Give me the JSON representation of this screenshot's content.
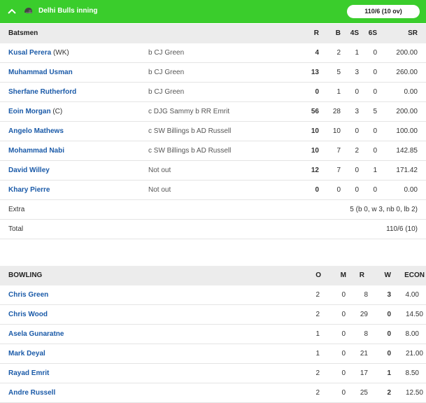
{
  "header": {
    "team_title": "Delhi Bulls inning",
    "score_pill": "110/6 (10 ov)"
  },
  "batting": {
    "columns": {
      "name": "Batsmen",
      "r": "R",
      "b": "B",
      "fours": "4S",
      "sixes": "6S",
      "sr": "SR"
    },
    "rows": [
      {
        "name": "Kusal Perera",
        "suffix": "(WK)",
        "dismissal": "b CJ Green",
        "r": "4",
        "b": "2",
        "fours": "1",
        "sixes": "0",
        "sr": "200.00"
      },
      {
        "name": "Muhammad Usman",
        "suffix": "",
        "dismissal": "b CJ Green",
        "r": "13",
        "b": "5",
        "fours": "3",
        "sixes": "0",
        "sr": "260.00"
      },
      {
        "name": "Sherfane Rutherford",
        "suffix": "",
        "dismissal": "b CJ Green",
        "r": "0",
        "b": "1",
        "fours": "0",
        "sixes": "0",
        "sr": "0.00"
      },
      {
        "name": "Eoin Morgan",
        "suffix": "(C)",
        "dismissal": "c DJG Sammy b RR Emrit",
        "r": "56",
        "b": "28",
        "fours": "3",
        "sixes": "5",
        "sr": "200.00"
      },
      {
        "name": "Angelo Mathews",
        "suffix": "",
        "dismissal": "c SW Billings b AD Russell",
        "r": "10",
        "b": "10",
        "fours": "0",
        "sixes": "0",
        "sr": "100.00"
      },
      {
        "name": "Mohammad Nabi",
        "suffix": "",
        "dismissal": "c SW Billings b AD Russell",
        "r": "10",
        "b": "7",
        "fours": "2",
        "sixes": "0",
        "sr": "142.85"
      },
      {
        "name": "David Willey",
        "suffix": "",
        "dismissal": "Not out",
        "r": "12",
        "b": "7",
        "fours": "0",
        "sixes": "1",
        "sr": "171.42"
      },
      {
        "name": "Khary Pierre",
        "suffix": "",
        "dismissal": "Not out",
        "r": "0",
        "b": "0",
        "fours": "0",
        "sixes": "0",
        "sr": "0.00"
      }
    ],
    "extra_label": "Extra",
    "extra_value": "5 (b 0, w 3, nb 0, lb 2)",
    "total_label": "Total",
    "total_value": "110/6 (10)"
  },
  "bowling": {
    "columns": {
      "name": "BOWLING",
      "o": "O",
      "m": "M",
      "r": "R",
      "w": "W",
      "econ": "ECON"
    },
    "rows": [
      {
        "name": "Chris Green",
        "o": "2",
        "m": "0",
        "r": "8",
        "w": "3",
        "econ": "4.00"
      },
      {
        "name": "Chris Wood",
        "o": "2",
        "m": "0",
        "r": "29",
        "w": "0",
        "econ": "14.50"
      },
      {
        "name": "Asela Gunaratne",
        "o": "1",
        "m": "0",
        "r": "8",
        "w": "0",
        "econ": "8.00"
      },
      {
        "name": "Mark Deyal",
        "o": "1",
        "m": "0",
        "r": "21",
        "w": "0",
        "econ": "21.00"
      },
      {
        "name": "Rayad Emrit",
        "o": "2",
        "m": "0",
        "r": "17",
        "w": "1",
        "econ": "8.50"
      },
      {
        "name": "Andre Russell",
        "o": "2",
        "m": "0",
        "r": "25",
        "w": "2",
        "econ": "12.50"
      }
    ]
  },
  "icons": {
    "collapse": "chevron-up-icon",
    "team": "helmet-icon"
  },
  "colors": {
    "header_bg": "#3acd2c",
    "link": "#1a5aa8",
    "section_bg": "#ececec"
  }
}
